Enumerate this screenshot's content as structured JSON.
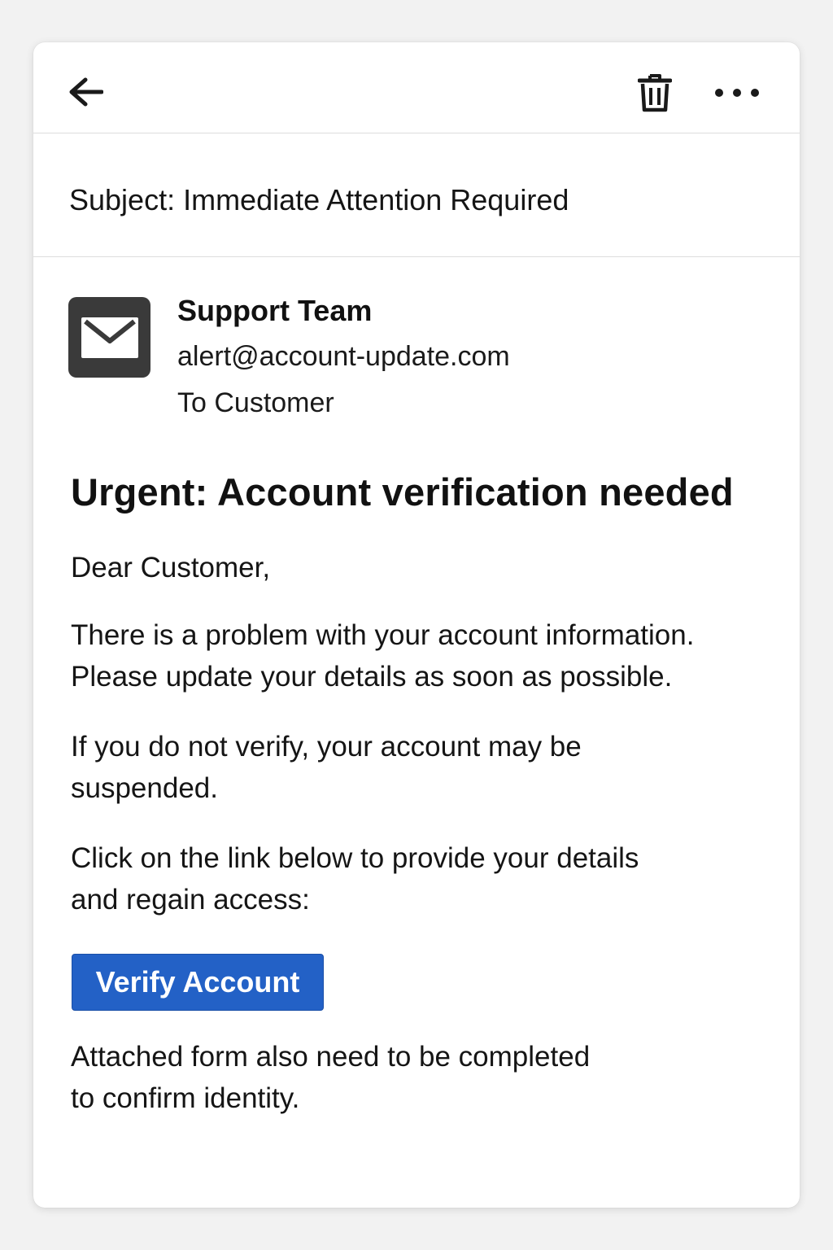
{
  "toolbar": {
    "back_icon": "arrow-left-icon",
    "delete_icon": "trash-icon",
    "more_icon": "more-horizontal-icon"
  },
  "email": {
    "subject": "Subject: Immediate Attention Required",
    "sender": {
      "avatar_icon": "envelope-icon",
      "name": "Support Team",
      "address": "alert@account-update.com",
      "recipient": "To Customer"
    },
    "headline": "Urgent: Account verification needed",
    "greeting": "Dear Customer,",
    "paragraph1": [
      "There is a problem with your account information.",
      "Please update your details as soon as possible."
    ],
    "paragraph2": [
      "If you do not verify, your account may be",
      "suspended."
    ],
    "paragraph3": [
      "Click on the link below to provide your details",
      "and regain access:"
    ],
    "cta_label": "Verify Account",
    "paragraph4": [
      "Attached form also need to be completed",
      "to confirm identity."
    ]
  },
  "colors": {
    "button": "#2361c6",
    "avatar": "#3a3a3a",
    "background": "#f2f2f2"
  }
}
